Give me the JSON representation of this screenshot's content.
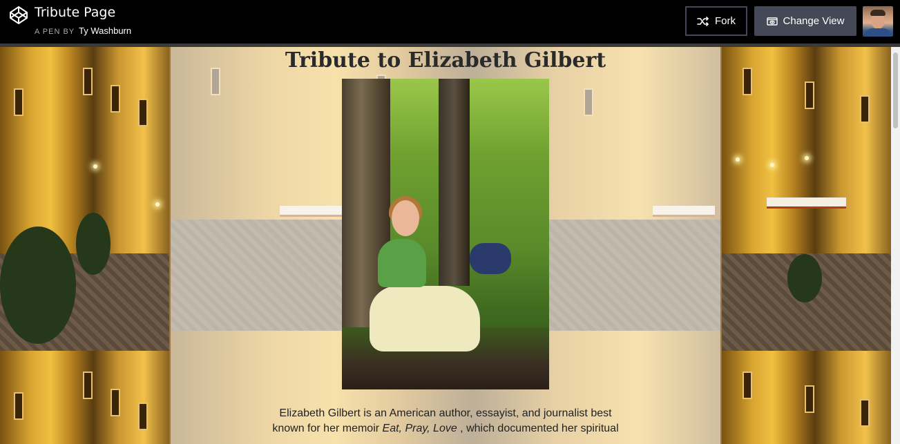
{
  "header": {
    "title": "Tribute Page",
    "byline_prefix": "A PEN BY",
    "author": "Ty Washburn",
    "fork_label": "Fork",
    "change_view_label": "Change View"
  },
  "tribute": {
    "heading": "Tribute to Elizabeth Gilbert",
    "bio_part1": "Elizabeth Gilbert is an American author, essayist, and journalist best known for her memoir ",
    "bio_italic": "Eat, Pray, Love",
    "bio_part2": " , which documented her spiritual"
  }
}
